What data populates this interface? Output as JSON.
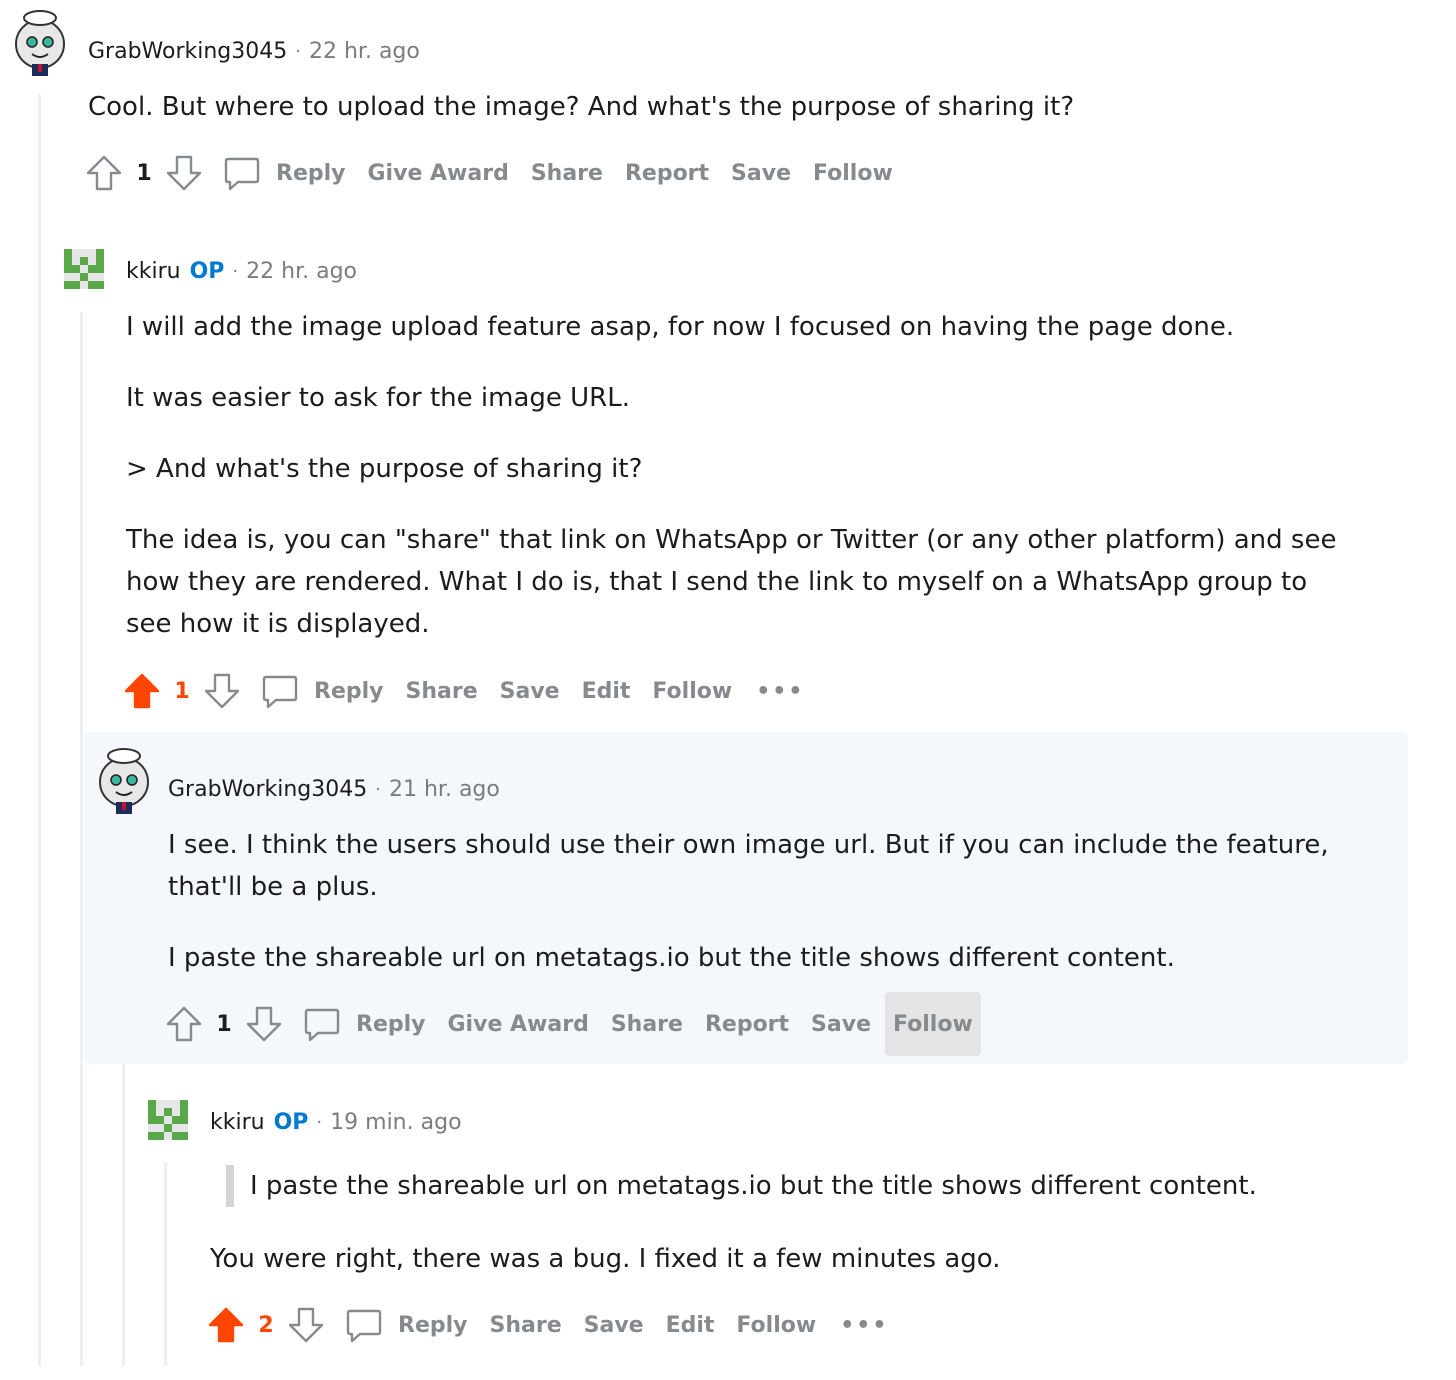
{
  "comments": [
    {
      "username": "GrabWorking3045",
      "time": "22 hr. ago",
      "paragraphs": [
        "Cool. But where to upload the image? And what's the purpose of sharing it?"
      ],
      "score": "1",
      "actions": [
        "Reply",
        "Give Award",
        "Share",
        "Report",
        "Save",
        "Follow"
      ]
    },
    {
      "username": "kkiru",
      "op_badge": "OP",
      "time": "22 hr. ago",
      "paragraphs": [
        "I will add the image upload feature asap, for now I focused on having the page done.",
        "It was easier to ask for the image URL.",
        "> And what's the purpose of sharing it?",
        "The idea is, you can \"share\" that link on WhatsApp or Twitter (or any other platform) and see how they are rendered. What I do is, that I send the link to myself on a WhatsApp group to see how it is displayed."
      ],
      "score": "1",
      "actions": [
        "Reply",
        "Share",
        "Save",
        "Edit",
        "Follow"
      ],
      "more": "•••"
    },
    {
      "username": "GrabWorking3045",
      "time": "21 hr. ago",
      "paragraphs": [
        "I see. I think the users should use their own image url. But if you can include the feature, that'll be a plus.",
        "I paste the shareable url on metatags.io but the title shows different content."
      ],
      "score": "1",
      "actions": [
        "Reply",
        "Give Award",
        "Share",
        "Report",
        "Save",
        "Follow"
      ]
    },
    {
      "username": "kkiru",
      "op_badge": "OP",
      "time": "19 min. ago",
      "quote": "I paste the shareable url on metatags.io but the title shows different content.",
      "paragraphs": [
        "You were right, there was a bug. I fixed it a few minutes ago."
      ],
      "score": "2",
      "actions": [
        "Reply",
        "Share",
        "Save",
        "Edit",
        "Follow"
      ],
      "more": "•••"
    }
  ],
  "meta_separator": "·",
  "colors": {
    "upvoted": "#ff4500",
    "op_badge": "#0079d3",
    "action_text": "#878a8c",
    "thread_line": "#edeff1",
    "highlight_bg": "#f4f8fc"
  },
  "icons": {
    "avatar_1": "snoo-avatar-icon",
    "avatar_2": "pixel-avatar-icon",
    "upvote": "upvote-arrow-icon",
    "downvote": "downvote-arrow-icon",
    "reply": "speech-bubble-icon"
  }
}
